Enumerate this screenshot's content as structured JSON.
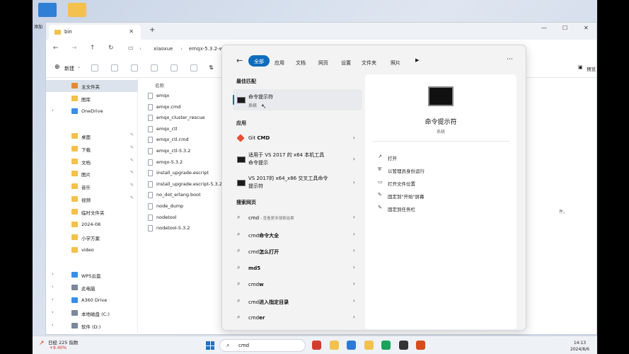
{
  "desktop": {
    "icons": [
      {
        "name": "desktop-icon-blue",
        "label": "",
        "color": "#2f7fd6"
      },
      {
        "name": "desktop-icon-folder",
        "label": "",
        "color": "#f2c14e"
      }
    ],
    "side_label": "添加"
  },
  "explorer": {
    "tab_title": "bin",
    "path": [
      "xiaoxue",
      "emqx-5.3.2-w"
    ],
    "new_button": "新建",
    "preview_button": "预览",
    "sidebar": [
      {
        "label": "主文件夹",
        "icon": "home-icon",
        "selected": true
      },
      {
        "label": "图库",
        "icon": "gallery-icon"
      },
      {
        "label": "OneDrive",
        "icon": "cloud-icon",
        "chevron": true
      },
      {
        "label": "桌面",
        "icon": "desktop-icon",
        "pin": true
      },
      {
        "label": "下载",
        "icon": "download-icon",
        "pin": true
      },
      {
        "label": "文档",
        "icon": "document-icon",
        "pin": true
      },
      {
        "label": "图片",
        "icon": "picture-icon",
        "pin": true
      },
      {
        "label": "音乐",
        "icon": "music-icon",
        "pin": true
      },
      {
        "label": "视频",
        "icon": "video-icon",
        "pin": true
      },
      {
        "label": "临时文件夹",
        "icon": "folder-icon"
      },
      {
        "label": "2024-08",
        "icon": "folder-icon"
      },
      {
        "label": "小学方案",
        "icon": "folder-icon"
      },
      {
        "label": "video",
        "icon": "folder-icon"
      },
      {
        "label": "WPS云盘",
        "icon": "cloud-icon",
        "chevron": true
      },
      {
        "label": "此电脑",
        "icon": "computer-icon",
        "chevron": true
      },
      {
        "label": "A360 Drive",
        "icon": "drive-icon",
        "chevron": true
      },
      {
        "label": "本地磁盘 (C:)",
        "icon": "disk-icon",
        "chevron": true
      },
      {
        "label": "软件 (D:)",
        "icon": "disk-icon",
        "chevron": true
      }
    ],
    "column_name": "名称",
    "files": [
      "emqx",
      "emqx.cmd",
      "emqx_cluster_rescue",
      "emqx_ctl",
      "emqx_ctl.cmd",
      "emqx_ctl-5.3.2",
      "emqx-5.3.2",
      "install_upgrade.escript",
      "install_upgrade.escript-5.3.2",
      "no_dot_erlang.boot",
      "node_dump",
      "nodetool",
      "nodetool-5.3.2"
    ],
    "right_note": "件。"
  },
  "search": {
    "filters": [
      "全部",
      "应用",
      "文档",
      "网页",
      "设置",
      "文件夹",
      "照片"
    ],
    "best_match_title": "最佳匹配",
    "best_match": {
      "title": "命令提示符",
      "sub": "系统"
    },
    "apps_title": "应用",
    "apps": [
      {
        "title_plain": "Git ",
        "title_bold": "CMD",
        "line2": ""
      },
      {
        "title_plain": "适用于 VS 2017 的 x64 本机工具",
        "line2": "命令提示"
      },
      {
        "title_plain": "VS 2017的 x64_x86 交叉工具命令",
        "line2": "提示符"
      }
    ],
    "web_title": "搜索网页",
    "web": [
      {
        "plain": "cmd",
        "bold": "",
        "hint": " - 查看更多搜索结果"
      },
      {
        "plain": "cmd",
        "bold": "命令大全",
        "hint": ""
      },
      {
        "plain": "cmd",
        "bold": "怎么打开",
        "hint": ""
      },
      {
        "plain": "",
        "bold": "md5",
        "hint": ""
      },
      {
        "plain": "cmd",
        "bold": "w",
        "hint": ""
      },
      {
        "plain": "cmd",
        "bold": "进入指定目录",
        "hint": ""
      },
      {
        "plain": "cmd",
        "bold": "er",
        "hint": ""
      }
    ],
    "detail": {
      "title": "命令提示符",
      "sub": "系统",
      "actions": [
        "打开",
        "以管理员身份运行",
        "打开文件位置",
        "固定到\"开始\"屏幕",
        "固定到任务栏"
      ]
    }
  },
  "taskbar": {
    "stock_name": "日经 225 指数",
    "stock_change": "+9.40%",
    "search_text": "cmd",
    "time": "14:13",
    "date": "2024/8/6",
    "apps": [
      {
        "name": "wps-app-icon",
        "color": "#d43b2f"
      },
      {
        "name": "file-explorer-icon",
        "color": "#f2c14e"
      },
      {
        "name": "store-icon",
        "color": "#2a7ad6"
      },
      {
        "name": "pin-app-icon",
        "color": "#f2c14e"
      },
      {
        "name": "browser-app-icon",
        "color": "#1aa35a"
      },
      {
        "name": "chrome-icon",
        "color": "#333333"
      },
      {
        "name": "office-icon",
        "color": "#d84a1b"
      }
    ]
  }
}
